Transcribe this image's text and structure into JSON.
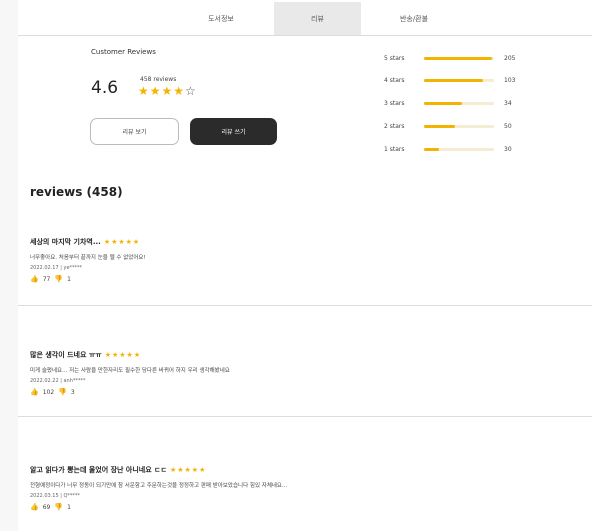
{
  "tabs": [
    {
      "label": "도서정보"
    },
    {
      "label": "리뷰"
    },
    {
      "label": "반송/환불"
    }
  ],
  "summary": {
    "title": "Customer Reviews",
    "average": "4.6",
    "count_label": "458 reviews",
    "stars": "★★★★",
    "empty_star": "☆",
    "rating": 4.6,
    "view_button": "리뷰 보기",
    "write_button": "리뷰 쓰기"
  },
  "histogram": [
    {
      "label": "5 stars",
      "count": "205",
      "fraction": 0.97
    },
    {
      "label": "4 stars",
      "count": "103",
      "fraction": 0.84
    },
    {
      "label": "3 stars",
      "count": "34",
      "fraction": 0.54
    },
    {
      "label": "2 stars",
      "count": "50",
      "fraction": 0.44
    },
    {
      "label": "1 stars",
      "count": "30",
      "fraction": 0.22
    }
  ],
  "reviews_heading": "reviews (458)",
  "reviews": [
    {
      "title": "세상의 마지막 기차역...",
      "stars": "★★★★★",
      "body": "너무좋아요. 처음부터 끝까지 눈을 뗄 수 없었어요!",
      "meta": "2022.02.17 | ye*****",
      "likes": "77",
      "dislikes": "1"
    },
    {
      "title": "많은 생각이 드네요 ㅠㅠ",
      "stars": "★★★★★",
      "body": "미게 슬펐네요... 저는 사람을 만한자리도 필수한 당다른 바뀌어 하지 우리 생각해봤네요",
      "meta": "2022.02.22 | anh*****",
      "likes": "102",
      "dislikes": "3"
    },
    {
      "title": "알고 읽다가 뽕는데 울었어 장난 아니네요 ㄷㄷ",
      "stars": "★★★★★",
      "body": "전형예정이다가 너무 정동이 되기만에 참 서운함고 주문하는것을 정정하고 판매 받아보았습니다 힘있 자체네요...",
      "meta": "2022.03.15 | Q*****",
      "likes": "69",
      "dislikes": "1"
    }
  ],
  "icons": {
    "thumbs_up": "thumbs-up-icon",
    "thumbs_down": "thumbs-down-icon"
  },
  "colors": {
    "star": "#f2b400",
    "active_tab": "#e9e9e9",
    "dark_button": "#2b2b2b"
  }
}
